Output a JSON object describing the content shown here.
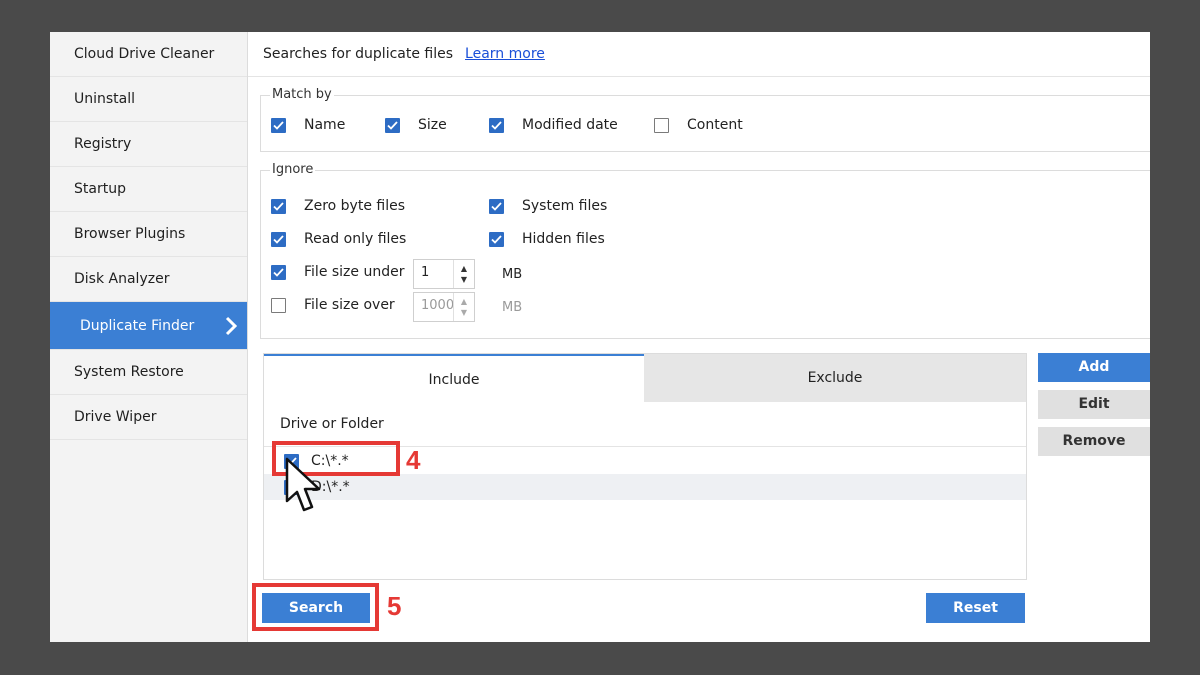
{
  "sidebar": {
    "items": [
      {
        "label": "Cloud Drive Cleaner"
      },
      {
        "label": "Uninstall"
      },
      {
        "label": "Registry"
      },
      {
        "label": "Startup"
      },
      {
        "label": "Browser Plugins"
      },
      {
        "label": "Disk Analyzer"
      },
      {
        "label": "Duplicate Finder",
        "active": true
      },
      {
        "label": "System Restore"
      },
      {
        "label": "Drive Wiper"
      }
    ],
    "active_chevron_icon": "chevron-right-icon"
  },
  "header": {
    "description": "Searches for duplicate files",
    "learn_more": "Learn more"
  },
  "match_by": {
    "label": "Match by",
    "options": [
      {
        "label": "Name",
        "checked": true
      },
      {
        "label": "Size",
        "checked": true
      },
      {
        "label": "Modified date",
        "checked": true
      },
      {
        "label": "Content",
        "checked": false
      }
    ]
  },
  "ignore": {
    "label": "Ignore",
    "zero_byte": {
      "label": "Zero byte files",
      "checked": true
    },
    "system_files": {
      "label": "System files",
      "checked": true
    },
    "read_only": {
      "label": "Read only files",
      "checked": true
    },
    "hidden_files": {
      "label": "Hidden files",
      "checked": true
    },
    "size_under": {
      "label": "File size under",
      "checked": true,
      "value": "1",
      "unit": "MB"
    },
    "size_over": {
      "label": "File size over",
      "checked": false,
      "value": "1000",
      "unit": "MB"
    }
  },
  "tabs": {
    "include": "Include",
    "exclude": "Exclude",
    "column_header": "Drive or Folder",
    "rows": [
      {
        "path": "C:\\*.*",
        "checked": true
      },
      {
        "path": "D:\\*.*",
        "checked": true
      }
    ]
  },
  "side_buttons": {
    "add": "Add",
    "edit": "Edit",
    "remove": "Remove"
  },
  "bottom_buttons": {
    "search": "Search",
    "reset": "Reset"
  },
  "annotations": {
    "step4": "4",
    "step5": "5"
  },
  "colors": {
    "accent": "#3b7fd4",
    "annotation": "#e53935",
    "checkbox": "#2d6cc4"
  }
}
